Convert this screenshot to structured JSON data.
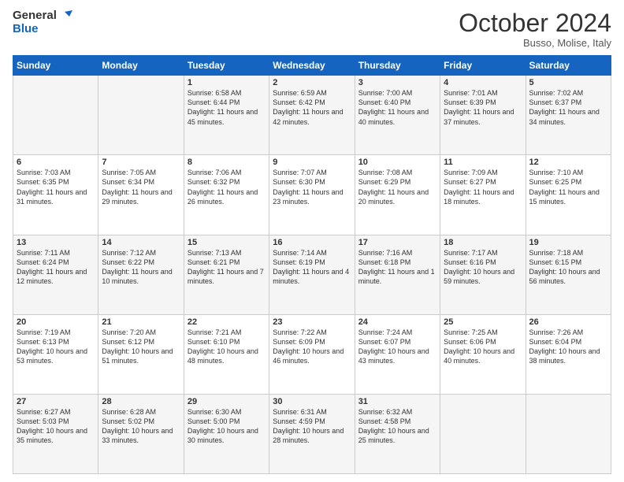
{
  "logo": {
    "line1": "General",
    "line2": "Blue"
  },
  "title": "October 2024",
  "location": "Busso, Molise, Italy",
  "weekdays": [
    "Sunday",
    "Monday",
    "Tuesday",
    "Wednesday",
    "Thursday",
    "Friday",
    "Saturday"
  ],
  "weeks": [
    [
      {
        "day": "",
        "info": ""
      },
      {
        "day": "",
        "info": ""
      },
      {
        "day": "1",
        "info": "Sunrise: 6:58 AM\nSunset: 6:44 PM\nDaylight: 11 hours and 45 minutes."
      },
      {
        "day": "2",
        "info": "Sunrise: 6:59 AM\nSunset: 6:42 PM\nDaylight: 11 hours and 42 minutes."
      },
      {
        "day": "3",
        "info": "Sunrise: 7:00 AM\nSunset: 6:40 PM\nDaylight: 11 hours and 40 minutes."
      },
      {
        "day": "4",
        "info": "Sunrise: 7:01 AM\nSunset: 6:39 PM\nDaylight: 11 hours and 37 minutes."
      },
      {
        "day": "5",
        "info": "Sunrise: 7:02 AM\nSunset: 6:37 PM\nDaylight: 11 hours and 34 minutes."
      }
    ],
    [
      {
        "day": "6",
        "info": "Sunrise: 7:03 AM\nSunset: 6:35 PM\nDaylight: 11 hours and 31 minutes."
      },
      {
        "day": "7",
        "info": "Sunrise: 7:05 AM\nSunset: 6:34 PM\nDaylight: 11 hours and 29 minutes."
      },
      {
        "day": "8",
        "info": "Sunrise: 7:06 AM\nSunset: 6:32 PM\nDaylight: 11 hours and 26 minutes."
      },
      {
        "day": "9",
        "info": "Sunrise: 7:07 AM\nSunset: 6:30 PM\nDaylight: 11 hours and 23 minutes."
      },
      {
        "day": "10",
        "info": "Sunrise: 7:08 AM\nSunset: 6:29 PM\nDaylight: 11 hours and 20 minutes."
      },
      {
        "day": "11",
        "info": "Sunrise: 7:09 AM\nSunset: 6:27 PM\nDaylight: 11 hours and 18 minutes."
      },
      {
        "day": "12",
        "info": "Sunrise: 7:10 AM\nSunset: 6:25 PM\nDaylight: 11 hours and 15 minutes."
      }
    ],
    [
      {
        "day": "13",
        "info": "Sunrise: 7:11 AM\nSunset: 6:24 PM\nDaylight: 11 hours and 12 minutes."
      },
      {
        "day": "14",
        "info": "Sunrise: 7:12 AM\nSunset: 6:22 PM\nDaylight: 11 hours and 10 minutes."
      },
      {
        "day": "15",
        "info": "Sunrise: 7:13 AM\nSunset: 6:21 PM\nDaylight: 11 hours and 7 minutes."
      },
      {
        "day": "16",
        "info": "Sunrise: 7:14 AM\nSunset: 6:19 PM\nDaylight: 11 hours and 4 minutes."
      },
      {
        "day": "17",
        "info": "Sunrise: 7:16 AM\nSunset: 6:18 PM\nDaylight: 11 hours and 1 minute."
      },
      {
        "day": "18",
        "info": "Sunrise: 7:17 AM\nSunset: 6:16 PM\nDaylight: 10 hours and 59 minutes."
      },
      {
        "day": "19",
        "info": "Sunrise: 7:18 AM\nSunset: 6:15 PM\nDaylight: 10 hours and 56 minutes."
      }
    ],
    [
      {
        "day": "20",
        "info": "Sunrise: 7:19 AM\nSunset: 6:13 PM\nDaylight: 10 hours and 53 minutes."
      },
      {
        "day": "21",
        "info": "Sunrise: 7:20 AM\nSunset: 6:12 PM\nDaylight: 10 hours and 51 minutes."
      },
      {
        "day": "22",
        "info": "Sunrise: 7:21 AM\nSunset: 6:10 PM\nDaylight: 10 hours and 48 minutes."
      },
      {
        "day": "23",
        "info": "Sunrise: 7:22 AM\nSunset: 6:09 PM\nDaylight: 10 hours and 46 minutes."
      },
      {
        "day": "24",
        "info": "Sunrise: 7:24 AM\nSunset: 6:07 PM\nDaylight: 10 hours and 43 minutes."
      },
      {
        "day": "25",
        "info": "Sunrise: 7:25 AM\nSunset: 6:06 PM\nDaylight: 10 hours and 40 minutes."
      },
      {
        "day": "26",
        "info": "Sunrise: 7:26 AM\nSunset: 6:04 PM\nDaylight: 10 hours and 38 minutes."
      }
    ],
    [
      {
        "day": "27",
        "info": "Sunrise: 6:27 AM\nSunset: 5:03 PM\nDaylight: 10 hours and 35 minutes."
      },
      {
        "day": "28",
        "info": "Sunrise: 6:28 AM\nSunset: 5:02 PM\nDaylight: 10 hours and 33 minutes."
      },
      {
        "day": "29",
        "info": "Sunrise: 6:30 AM\nSunset: 5:00 PM\nDaylight: 10 hours and 30 minutes."
      },
      {
        "day": "30",
        "info": "Sunrise: 6:31 AM\nSunset: 4:59 PM\nDaylight: 10 hours and 28 minutes."
      },
      {
        "day": "31",
        "info": "Sunrise: 6:32 AM\nSunset: 4:58 PM\nDaylight: 10 hours and 25 minutes."
      },
      {
        "day": "",
        "info": ""
      },
      {
        "day": "",
        "info": ""
      }
    ]
  ]
}
